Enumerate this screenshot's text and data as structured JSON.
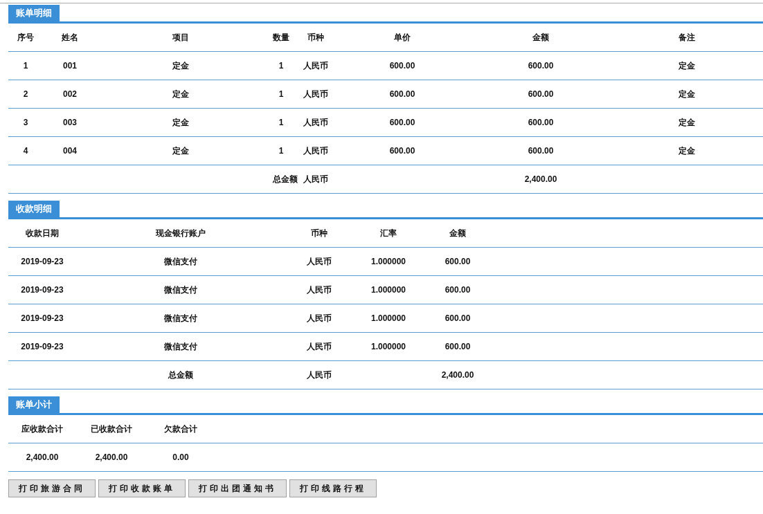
{
  "bill_details": {
    "title": "账单明细",
    "columns": [
      "序号",
      "姓名",
      "项目",
      "数量",
      "币种",
      "单价",
      "金额",
      "备注"
    ],
    "rows": [
      [
        "1",
        "001",
        "定金",
        "1",
        "人民币",
        "600.00",
        "600.00",
        "定金"
      ],
      [
        "2",
        "002",
        "定金",
        "1",
        "人民币",
        "600.00",
        "600.00",
        "定金"
      ],
      [
        "3",
        "003",
        "定金",
        "1",
        "人民币",
        "600.00",
        "600.00",
        "定金"
      ],
      [
        "4",
        "004",
        "定金",
        "1",
        "人民币",
        "600.00",
        "600.00",
        "定金"
      ]
    ],
    "total": {
      "label": "总金额",
      "currency": "人民币",
      "amount": "2,400.00"
    }
  },
  "payment_details": {
    "title": "收款明细",
    "columns": [
      "收款日期",
      "现金银行账户",
      "币种",
      "汇率",
      "金额"
    ],
    "rows": [
      [
        "2019-09-23",
        "微信支付",
        "人民币",
        "1.000000",
        "600.00"
      ],
      [
        "2019-09-23",
        "微信支付",
        "人民币",
        "1.000000",
        "600.00"
      ],
      [
        "2019-09-23",
        "微信支付",
        "人民币",
        "1.000000",
        "600.00"
      ],
      [
        "2019-09-23",
        "微信支付",
        "人民币",
        "1.000000",
        "600.00"
      ]
    ],
    "total": {
      "label": "总金额",
      "currency": "人民币",
      "amount": "2,400.00"
    }
  },
  "bill_summary": {
    "title": "账单小计",
    "columns": [
      "应收款合计",
      "已收款合计",
      "欠款合计"
    ],
    "rows": [
      [
        "2,400.00",
        "2,400.00",
        "0.00"
      ]
    ]
  },
  "buttons": [
    "打印旅游合同",
    "打印收款账单",
    "打印出团通知书",
    "打印线路行程"
  ]
}
